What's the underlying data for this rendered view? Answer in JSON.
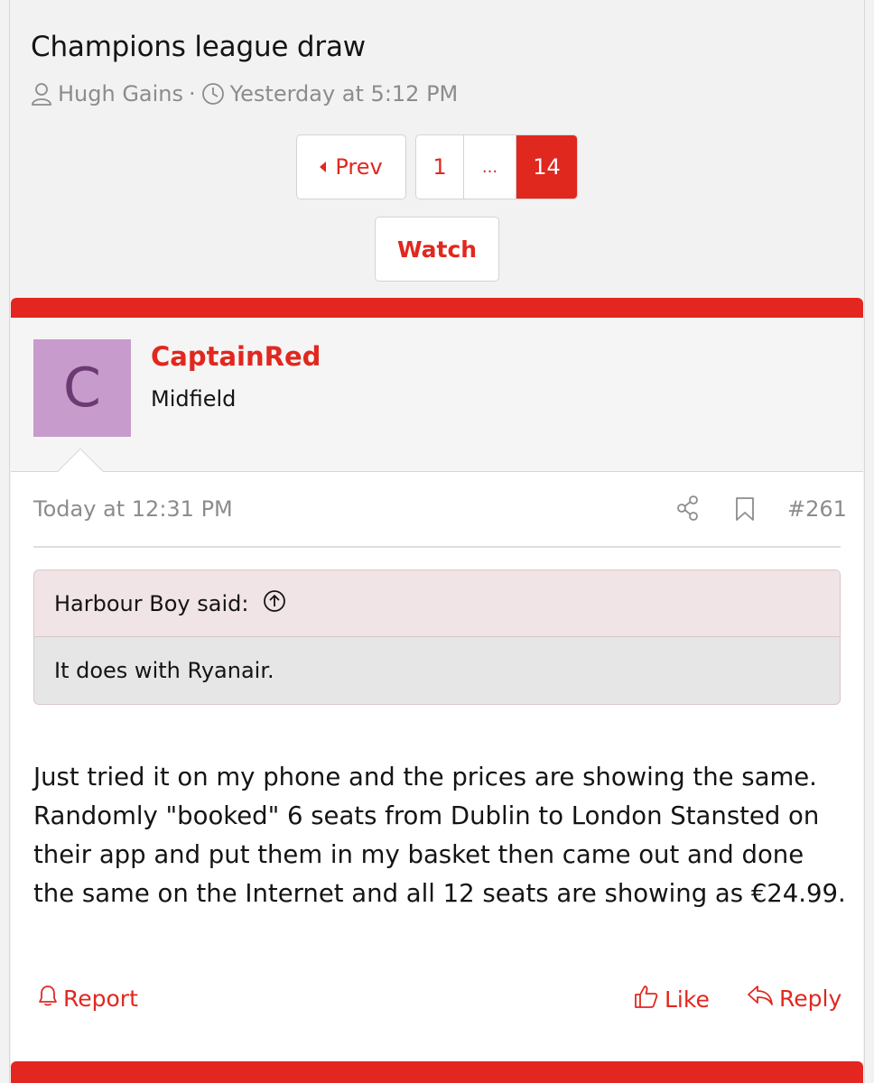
{
  "thread": {
    "title": "Champions league draw",
    "author": "Hugh Gains",
    "separator": "·",
    "time": "Yesterday at 5:12 PM"
  },
  "pagination": {
    "prev_label": "Prev",
    "pages": [
      "1",
      "...",
      "14"
    ],
    "current": "14"
  },
  "watch_label": "Watch",
  "post": {
    "avatar_letter": "C",
    "username": "CaptainRed",
    "user_title": "Midfield",
    "date": "Today at 12:31 PM",
    "number": "#261",
    "quote": {
      "attribution": "Harbour Boy said:",
      "text": "It does with Ryanair."
    },
    "body": "Just tried it on my phone and the prices are showing the same. Randomly \"booked\" 6 seats from Dublin to London Stansted on their app and put them in my basket then came out and done the same on the Internet and all 12 seats are showing as €24.99.",
    "actions": {
      "report": "Report",
      "like": "Like",
      "reply": "Reply"
    }
  },
  "colors": {
    "accent": "#e0281f",
    "avatar_bg": "#c79bcc",
    "avatar_letter": "#6b3a73"
  }
}
